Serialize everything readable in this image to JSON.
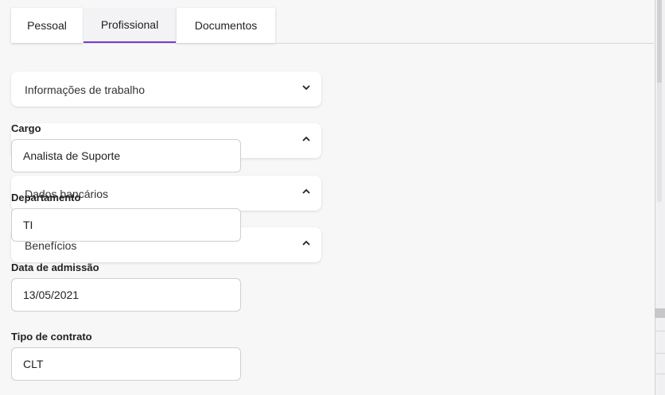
{
  "tabs": [
    {
      "label": "Pessoal"
    },
    {
      "label": "Profissional"
    },
    {
      "label": "Documentos"
    }
  ],
  "accordions": [
    {
      "title": "Informações de trabalho",
      "state": "collapsed",
      "icon": "chevron-down-icon"
    },
    {
      "title": "",
      "state": "expanded",
      "icon": "chevron-up-icon"
    },
    {
      "title": "Dados bancários",
      "state": "expanded",
      "icon": "chevron-up-icon"
    },
    {
      "title": "Benefícios",
      "state": "expanded",
      "icon": "chevron-up-icon"
    }
  ],
  "form": {
    "cargo": {
      "label": "Cargo",
      "value": "Analista de Suporte"
    },
    "departamento": {
      "label": "Departamento",
      "value": "TI"
    },
    "admissao": {
      "label": "Data de admissão",
      "value": "13/05/2021"
    },
    "contrato": {
      "label": "Tipo de contrato",
      "value": "CLT"
    }
  },
  "colors": {
    "accent": "#7a3ed6"
  }
}
